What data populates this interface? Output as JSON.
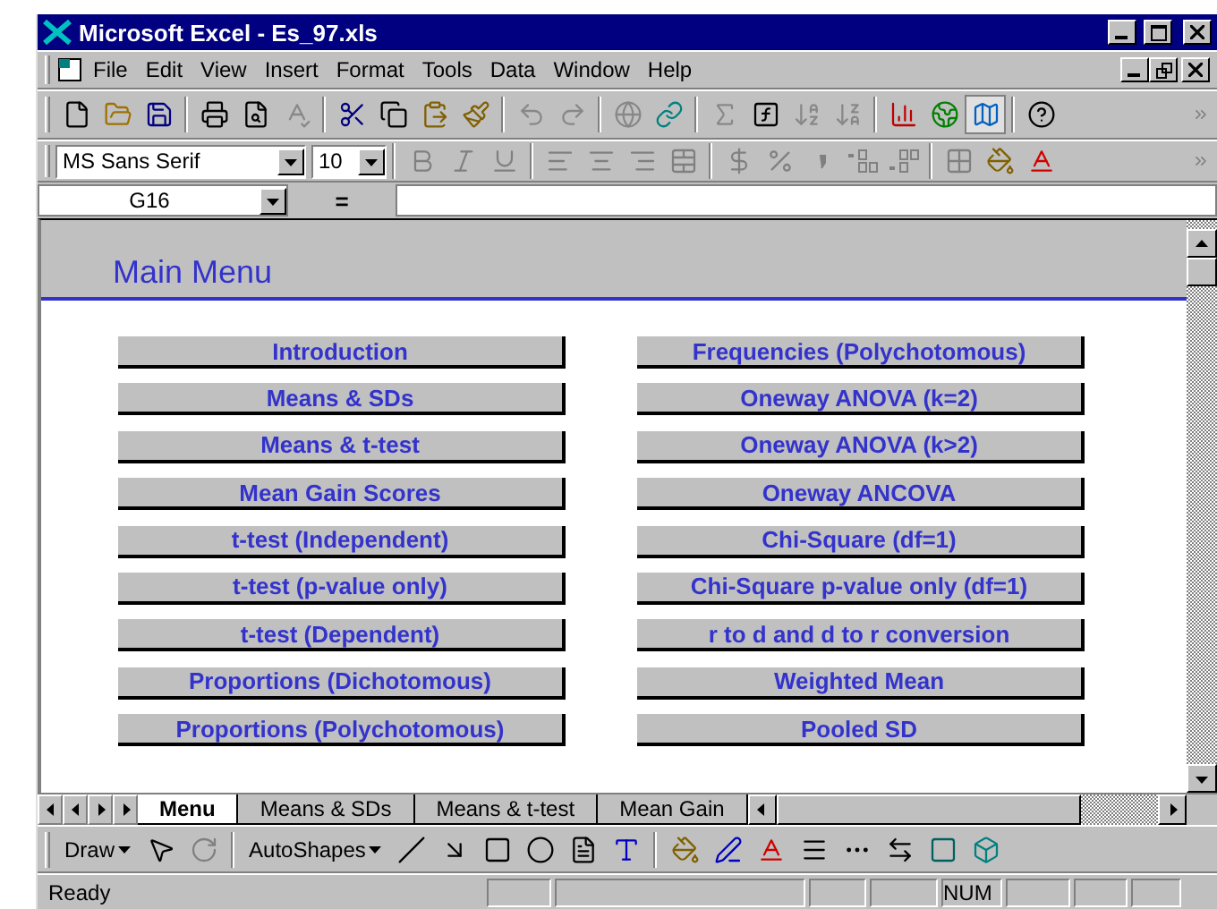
{
  "window": {
    "title": "Microsoft Excel - Es_97.xls"
  },
  "menu_bar": [
    "File",
    "Edit",
    "View",
    "Insert",
    "Format",
    "Tools",
    "Data",
    "Window",
    "Help"
  ],
  "format_toolbar": {
    "font": "MS Sans Serif",
    "size": "10"
  },
  "formula_bar": {
    "name_box": "G16",
    "equals": "="
  },
  "sheet": {
    "title": "Main Menu",
    "buttons_left": [
      "Introduction",
      "Means & SDs",
      "Means & t-test",
      "Mean Gain Scores",
      "t-test (Independent)",
      "t-test (p-value only)",
      "t-test (Dependent)",
      "Proportions (Dichotomous)",
      "Proportions (Polychotomous)"
    ],
    "buttons_right": [
      "Frequencies (Polychotomous)",
      "Oneway ANOVA (k=2)",
      "Oneway ANOVA (k>2)",
      "Oneway ANCOVA",
      "Chi-Square (df=1)",
      "Chi-Square p-value only (df=1)",
      "r to d and d to r conversion",
      "Weighted Mean",
      "Pooled SD"
    ]
  },
  "sheet_tabs": [
    {
      "label": "Menu",
      "selected": true
    },
    {
      "label": "Means & SDs",
      "selected": false
    },
    {
      "label": "Means & t-test",
      "selected": false
    },
    {
      "label": "Mean Gain",
      "selected": false
    }
  ],
  "drawing_toolbar": {
    "draw": "Draw",
    "autoshapes": "AutoShapes"
  },
  "status_bar": {
    "text": "Ready",
    "num": "NUM"
  }
}
